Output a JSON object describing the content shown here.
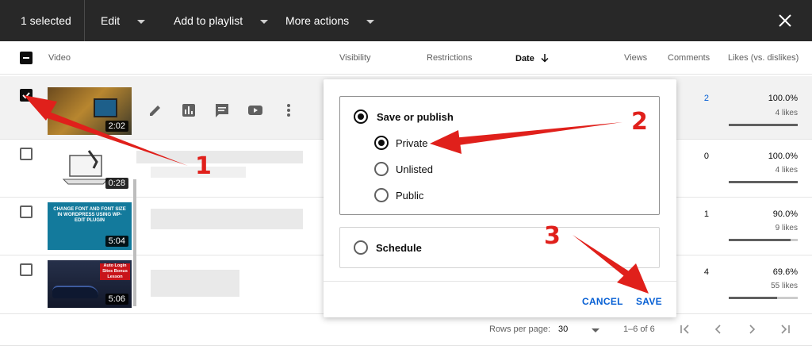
{
  "topbar": {
    "selected_count": "1 selected",
    "edit": "Edit",
    "add_to_playlist": "Add to playlist",
    "more_actions": "More actions"
  },
  "header": {
    "video": "Video",
    "visibility": "Visibility",
    "restrictions": "Restrictions",
    "date": "Date",
    "views": "Views",
    "comments": "Comments",
    "likes": "Likes (vs. dislikes)"
  },
  "rows": [
    {
      "selected": true,
      "duration": "2:02",
      "thumb_text": "...",
      "comments": "2",
      "likes_pct": "100.0%",
      "likes_count": "4 likes",
      "likes_ratio": 1.0
    },
    {
      "selected": false,
      "duration": "0:28",
      "comments": "0",
      "likes_pct": "100.0%",
      "likes_count": "4 likes",
      "likes_ratio": 1.0
    },
    {
      "selected": false,
      "duration": "5:04",
      "thumb_text": "CHANGE FONT AND FONT SIZE IN WORDPRESS USING WP-EDIT PLUGIN",
      "comments": "1",
      "likes_pct": "90.0%",
      "likes_count": "9 likes",
      "likes_ratio": 0.9
    },
    {
      "selected": false,
      "duration": "5:06",
      "thumb_text": "Auto Login Sites Bonus Lesson",
      "comments": "4",
      "likes_pct": "69.6%",
      "likes_count": "55 likes",
      "likes_ratio": 0.696
    }
  ],
  "footer": {
    "rows_per_page_label": "Rows per page:",
    "rows_per_page_value": "30",
    "range": "1–6 of 6"
  },
  "popup": {
    "save_or_publish": "Save or publish",
    "private": "Private",
    "unlisted": "Unlisted",
    "public": "Public",
    "schedule": "Schedule",
    "cancel": "CANCEL",
    "save": "SAVE"
  },
  "annotations": {
    "step1": "1",
    "step2": "2",
    "step3": "3"
  },
  "colors": {
    "topbar": "#282828",
    "link_blue": "#065fd4",
    "annotation_red": "#e0201b"
  },
  "icons": [
    "dropdown-caret-icon",
    "close-icon",
    "sort-arrow-down-icon",
    "pencil-icon",
    "analytics-icon",
    "comments-icon",
    "youtube-icon",
    "more-vert-icon",
    "first-page-icon",
    "prev-page-icon",
    "next-page-icon",
    "last-page-icon"
  ]
}
